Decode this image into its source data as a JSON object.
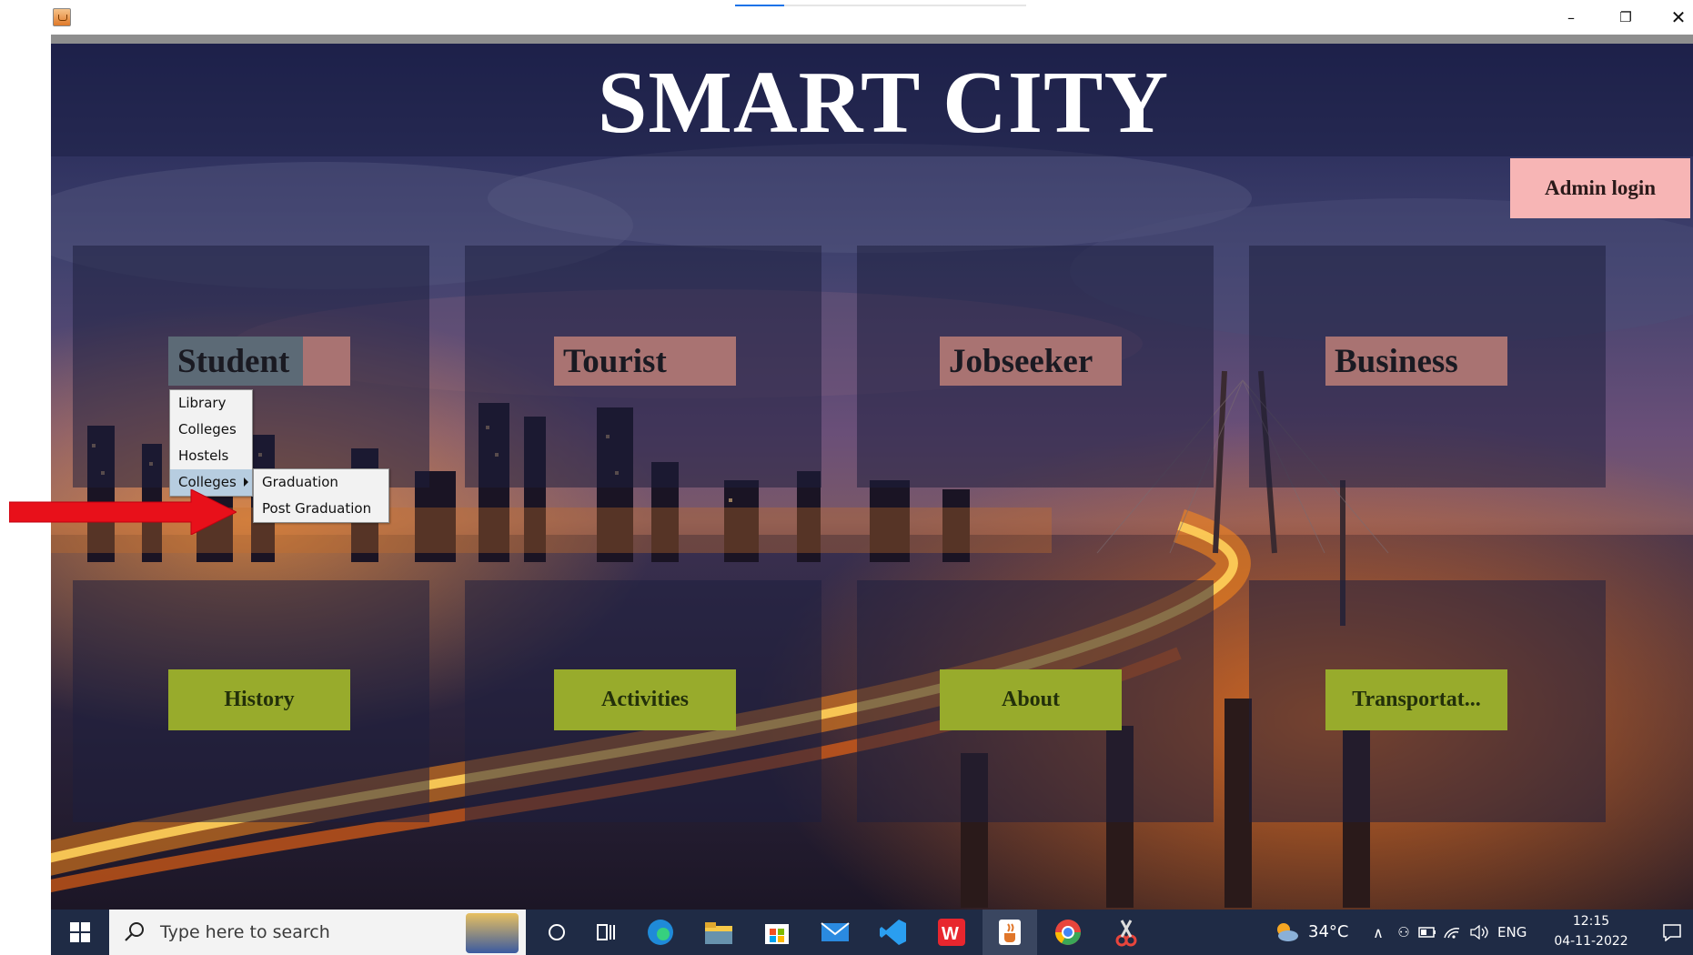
{
  "window": {
    "title": "",
    "controls": {
      "minimize": "–",
      "restore": "❐",
      "close": "✕"
    }
  },
  "app": {
    "title": "SMART CITY",
    "admin_label": "Admin login",
    "categories": [
      {
        "label": "Student"
      },
      {
        "label": "Tourist"
      },
      {
        "label": "Jobseeker"
      },
      {
        "label": "Business"
      }
    ],
    "info_buttons": [
      {
        "label": "History"
      },
      {
        "label": "Activities"
      },
      {
        "label": "About"
      },
      {
        "label": "Transportat..."
      }
    ],
    "student_menu": {
      "items": [
        {
          "label": "Library"
        },
        {
          "label": "Colleges"
        },
        {
          "label": "Hostels"
        },
        {
          "label": "Colleges",
          "selected": true,
          "has_submenu": true
        }
      ]
    },
    "colleges_submenu": {
      "items": [
        {
          "label": "Graduation"
        },
        {
          "label": "Post Graduation"
        }
      ]
    }
  },
  "taskbar": {
    "search_placeholder": "Type here to search",
    "weather": "34°C",
    "language": "ENG",
    "time": "12:15",
    "date": "04-11-2022",
    "apps": [
      "cortana-icon",
      "task-view-icon",
      "edge-icon",
      "file-explorer-icon",
      "store-icon",
      "mail-icon",
      "vscode-icon",
      "wps-office-icon",
      "java-app-icon",
      "chrome-icon",
      "snipping-tool-icon"
    ]
  },
  "colors": {
    "category_button": "#a97372",
    "info_button": "#98ab2c",
    "admin_button": "#f7b5b5",
    "annotation_arrow": "#e8101a",
    "menu_selected": "#b7cde0"
  }
}
